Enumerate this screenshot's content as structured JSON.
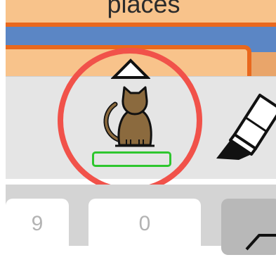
{
  "folder": {
    "title": "places"
  },
  "suggestion_bar": {
    "items": [
      {
        "icon": "cat-icon",
        "label": ""
      },
      {
        "icon": "eraser-icon"
      }
    ],
    "collapse_icon": "chevron-up-icon"
  },
  "keys": {
    "nine": "9",
    "zero": "0",
    "delete_icon": "delete-key-icon"
  },
  "colors": {
    "folder": "#f8c38b",
    "folder_border": "#e9681d",
    "band": "#5b86c5",
    "highlight": "#f1524a",
    "label_border": "#2ec62e"
  }
}
